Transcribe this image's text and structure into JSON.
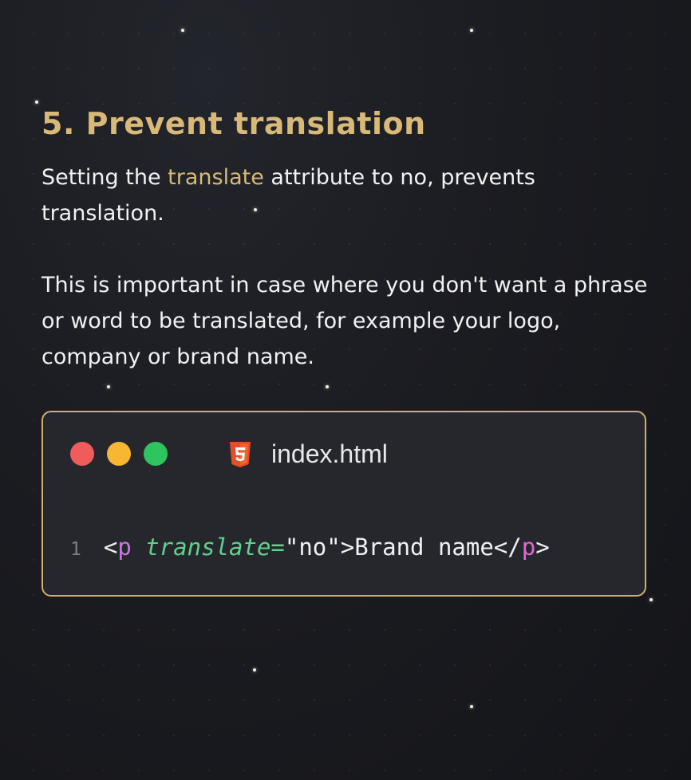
{
  "heading": {
    "title": "5. Prevent translation"
  },
  "paragraph1": {
    "before": "Setting the ",
    "keyword": "translate",
    "after": " attribute to no, prevents translation."
  },
  "paragraph2": {
    "text": "This is important in case where you don't want a phrase or word to be translated, for example your logo, company or brand name."
  },
  "code_window": {
    "file_name": "index.html",
    "file_icon": "html5-icon",
    "window_dots": [
      "close-dot",
      "minimize-dot",
      "maximize-dot"
    ],
    "line_number": "1",
    "code": {
      "open_bracket": "<",
      "tag": "p",
      "attr_name": "translate",
      "equals": "=",
      "attr_value": "\"no\"",
      "close_bracket": ">",
      "content": "Brand name",
      "end_open": "</",
      "end_tag": "p",
      "end_close": ">"
    }
  },
  "colors": {
    "accent": "#d8b978",
    "background": "#1b1c21",
    "code_border": "#cfae6e",
    "dot_red": "#f05b5b",
    "dot_yellow": "#f7b733",
    "dot_green": "#2fc55e",
    "html5_orange": "#e44d26"
  }
}
